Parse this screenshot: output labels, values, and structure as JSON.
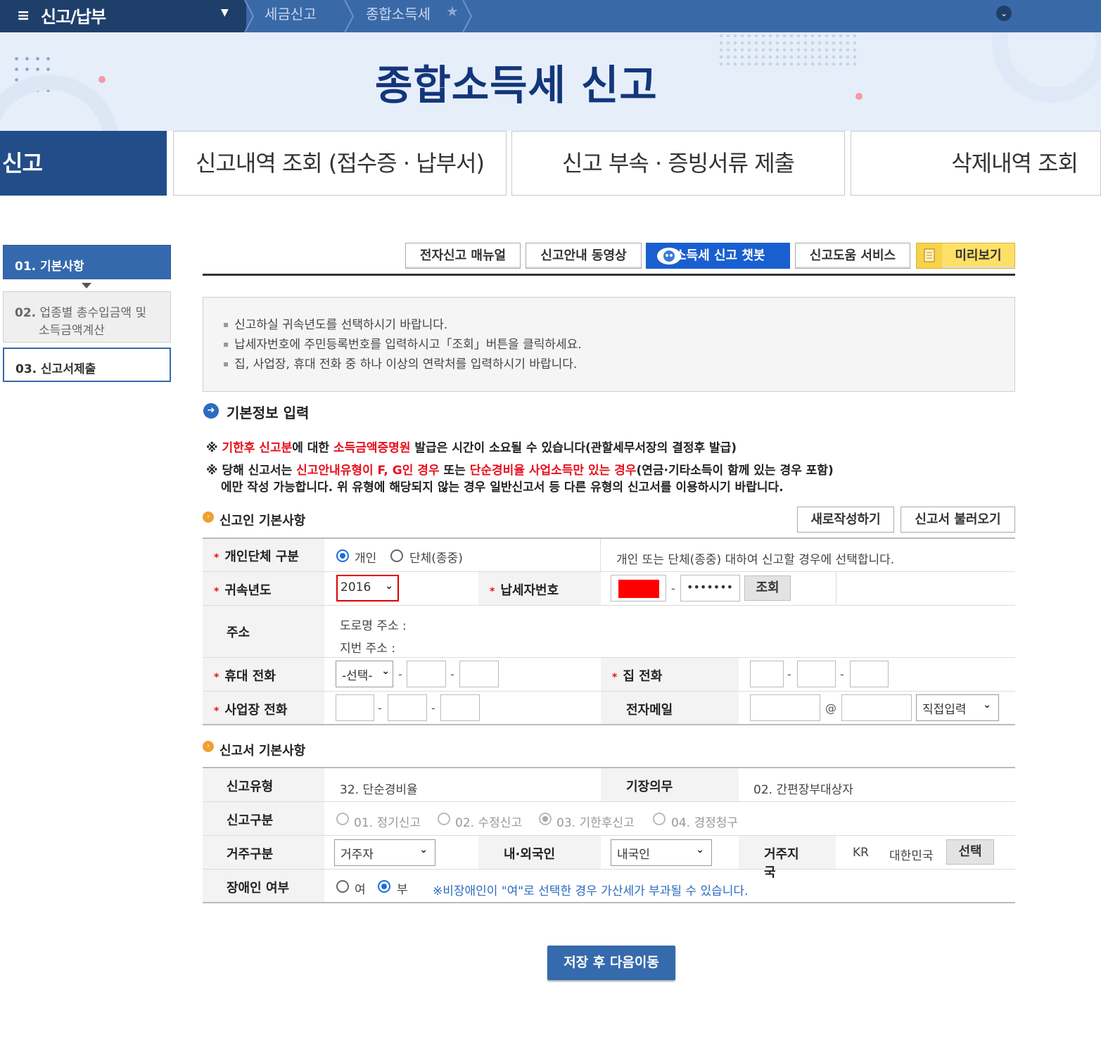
{
  "topnav": {
    "menu_title": "신고/납부",
    "crumb1": "세금신고",
    "crumb2": "종합소득세"
  },
  "hero": {
    "title": "종합소득세 신고"
  },
  "tabs": [
    {
      "label": "신고"
    },
    {
      "label": "신고내역 조회 (접수증 · 납부서)"
    },
    {
      "label": "신고 부속 · 증빙서류 제출"
    },
    {
      "label": "삭제내역 조회"
    }
  ],
  "steps": {
    "s1_num": "01.",
    "s1_label": "기본사항",
    "s2_num": "02.",
    "s2_label": "업종별 총수입금액 및",
    "s2_label2": "소득금액계산",
    "s3_num": "03.",
    "s3_label": "신고서제출"
  },
  "toolbar": {
    "manual": "전자신고 매뉴얼",
    "video": "신고안내 동영상",
    "chatbot": "소득세 신고 챗봇",
    "help": "신고도움 서비스",
    "preview": "미리보기"
  },
  "notice": [
    "신고하실 귀속년도를 선택하시기 바랍니다.",
    "납세자번호에 주민등록번호를 입력하시고「조회」버튼을 클릭하세요.",
    "집, 사업장, 휴대 전화 중 하나 이상의 연락처를 입력하시기 바랍니다."
  ],
  "basic_info_title": "기본정보 입력",
  "warnings": {
    "w1_mark": "※",
    "w1_red1": "기한후 신고분",
    "w1_t1": "에 대한",
    "w1_red2": "소득금액증명원",
    "w1_t2": "발급은 시간이 소요될 수 있습니다(관할세무서장의 결정후 발급)",
    "w2_mark": "※",
    "w2_t1": "당해 신고서는",
    "w2_red1": "신고안내유형이 F, G인 경우",
    "w2_t2": "또는",
    "w2_red2": "단순경비율 사업소득만 있는 경우",
    "w2_t3": "(연금·기타소득이 함께 있는 경우 포함)",
    "w2_line2": "에만 작성 가능합니다. 위 유형에 해당되지 않는 경우 일반신고서 등 다른 유형의 신고서를 이용하시기 바랍니다."
  },
  "reporter": {
    "title": "신고인 기본사항",
    "new_btn": "새로작성하기",
    "load_btn": "신고서 불러오기",
    "type_label": "개인단체 구분",
    "type_opt1": "개인",
    "type_opt2": "단체(종중)",
    "type_help": "개인 또는 단체(종중) 대하여 신고할 경우에 선택합니다.",
    "year_label": "귀속년도",
    "year_value": "2016",
    "taxno_label": "납세자번호",
    "taxno_dash": "-",
    "taxno_masked": "•••••••",
    "lookup_btn": "조회",
    "addr_label": "주소",
    "addr_road": "도로명 주소 :",
    "addr_lot": "지번 주소 :",
    "mobile_label": "휴대 전화",
    "mobile_select": "-선택-",
    "dash": "-",
    "home_label": "집 전화",
    "biz_label": "사업장 전화",
    "email_label": "전자메일",
    "at": "@",
    "email_domain": "직접입력"
  },
  "report": {
    "title": "신고서 기본사항",
    "type_label": "신고유형",
    "type_value": "32. 단순경비율",
    "book_label": "기장의무",
    "book_value": "02. 간편장부대상자",
    "kind_label": "신고구분",
    "kind_opts": [
      "01. 정기신고",
      "02. 수정신고",
      "03. 기한후신고",
      "04. 경정청구"
    ],
    "resid_label": "거주구분",
    "resid_value": "거주자",
    "nat_label": "내·외국인",
    "nat_value": "내국인",
    "country_label": "거주지국",
    "country_code": "KR",
    "country_name": "대한민국",
    "country_btn": "선택",
    "disabled_label": "장애인 여부",
    "dis_yes": "여",
    "dis_no": "부",
    "dis_note": "※비장애인이 \"여\"로 선택한 경우 가산세가 부과될 수 있습니다."
  },
  "save_btn": "저장 후 다음이동",
  "colors": {
    "topbar": "#3a69a8",
    "menu": "#1f3f6b",
    "hero_title": "#13367a",
    "active_tab": "#234d88",
    "accent_red": "#e8101c",
    "chatbot_blue": "#1a5fcf",
    "preview_yellow": "#ffe066"
  }
}
